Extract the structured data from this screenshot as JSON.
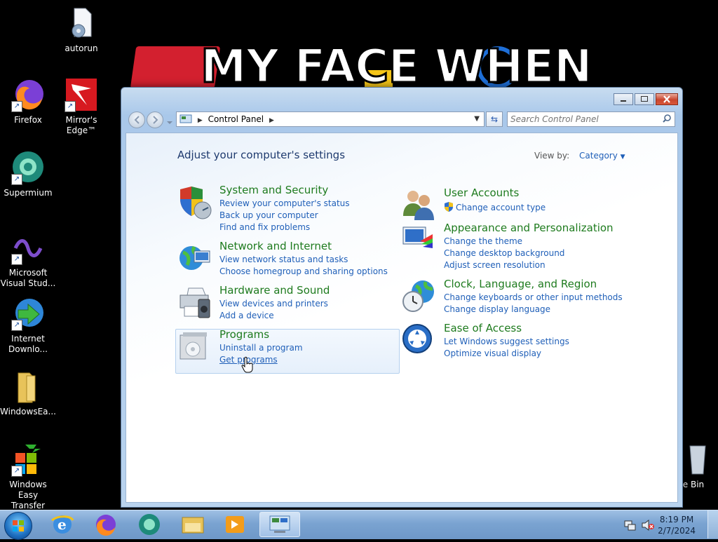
{
  "desktop": {
    "wallpaper_text": "MY FACE WHEN",
    "icons": [
      {
        "label": "autorun",
        "icon": "settings-file-icon"
      },
      {
        "label": "Firefox",
        "icon": "firefox-icon"
      },
      {
        "label": "Mirror's Edge™",
        "icon": "mirrors-edge-icon"
      },
      {
        "label": "Supermium",
        "icon": "supermium-icon"
      },
      {
        "label": "Microsoft Visual Stud...",
        "icon": "visual-studio-icon"
      },
      {
        "label": "Internet Downlo...",
        "icon": "internet-download-icon"
      },
      {
        "label": "WindowsEa...",
        "icon": "folder-icon"
      },
      {
        "label": "Windows Easy Transfer",
        "icon": "easy-transfer-icon"
      },
      {
        "label": "cle Bin",
        "icon": "recycle-bin-icon"
      }
    ]
  },
  "window": {
    "address": "Control Panel",
    "search_placeholder": "Search Control Panel",
    "heading": "Adjust your computer's settings",
    "view_by_label": "View by:",
    "view_by_value": "Category",
    "categories": [
      {
        "title": "System and Security",
        "links": [
          "Review your computer's status",
          "Back up your computer",
          "Find and fix problems"
        ]
      },
      {
        "title": "Network and Internet",
        "links": [
          "View network status and tasks",
          "Choose homegroup and sharing options"
        ]
      },
      {
        "title": "Hardware and Sound",
        "links": [
          "View devices and printers",
          "Add a device"
        ]
      },
      {
        "title": "Programs",
        "links": [
          "Uninstall a program",
          "Get programs"
        ]
      },
      {
        "title": "User Accounts",
        "links": [
          "Change account type"
        ]
      },
      {
        "title": "Appearance and Personalization",
        "links": [
          "Change the theme",
          "Change desktop background",
          "Adjust screen resolution"
        ]
      },
      {
        "title": "Clock, Language, and Region",
        "links": [
          "Change keyboards or other input methods",
          "Change display language"
        ]
      },
      {
        "title": "Ease of Access",
        "links": [
          "Let Windows suggest settings",
          "Optimize visual display"
        ]
      }
    ]
  },
  "taskbar": {
    "time": "8:19 PM",
    "date": "2/7/2024",
    "pinned": [
      "internet-explorer-icon",
      "firefox-icon",
      "supermium-icon",
      "explorer-icon",
      "media-player-icon",
      "control-panel-icon"
    ]
  }
}
